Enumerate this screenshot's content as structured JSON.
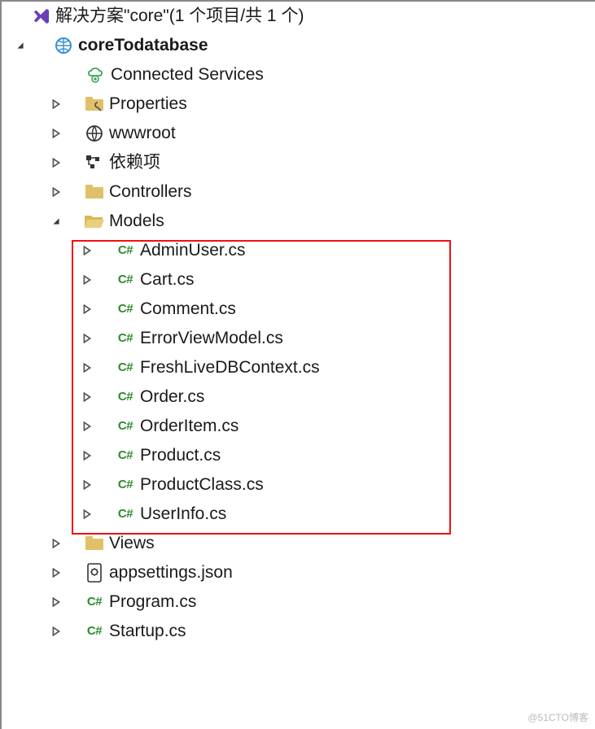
{
  "solution_label": "解决方案\"core\"(1 个项目/共 1 个)",
  "project_name": "coreTodatabase",
  "nodes": {
    "connected": "Connected Services",
    "properties": "Properties",
    "wwwroot": "wwwroot",
    "deps": "依赖项",
    "controllers": "Controllers",
    "models_folder": "Models",
    "views": "Views",
    "appsettings": "appsettings.json",
    "program": "Program.cs",
    "startup": "Startup.cs"
  },
  "models": [
    "AdminUser.cs",
    "Cart.cs",
    "Comment.cs",
    "ErrorViewModel.cs",
    "FreshLiveDBContext.cs",
    "Order.cs",
    "OrderItem.cs",
    "Product.cs",
    "ProductClass.cs",
    "UserInfo.cs"
  ],
  "cs_tag": "C#",
  "watermark": "@51CTO博客"
}
